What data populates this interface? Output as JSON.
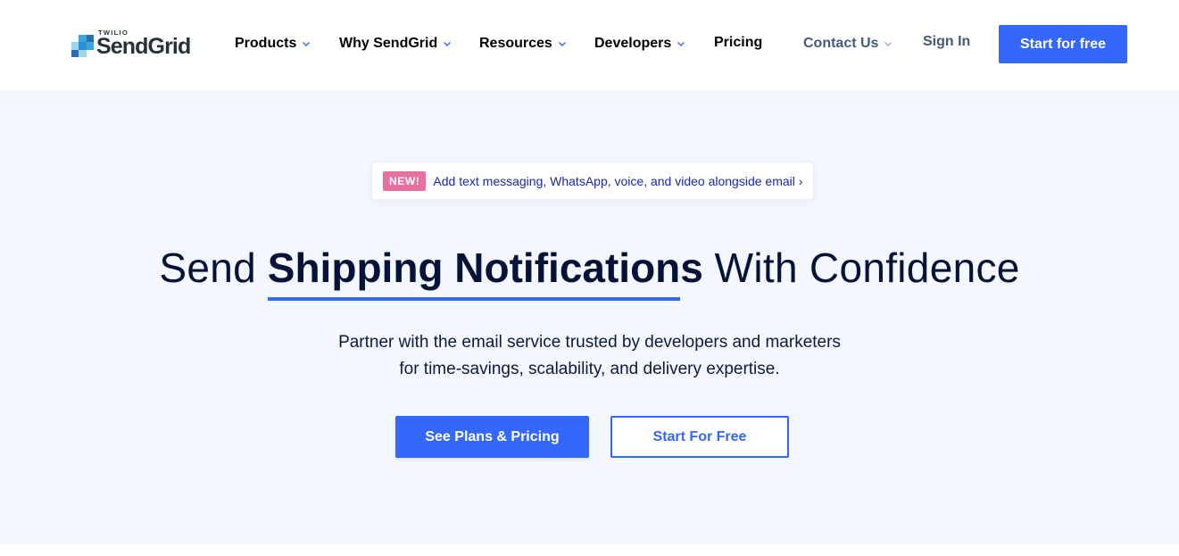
{
  "header": {
    "logo": {
      "small_text": "TWILIO",
      "brand": "SendGrid"
    },
    "nav": [
      {
        "label": "Products",
        "has_dropdown": true
      },
      {
        "label": "Why SendGrid",
        "has_dropdown": true
      },
      {
        "label": "Resources",
        "has_dropdown": true
      },
      {
        "label": "Developers",
        "has_dropdown": true
      },
      {
        "label": "Pricing",
        "has_dropdown": false
      }
    ],
    "contact_label": "Contact Us",
    "signin_label": "Sign In",
    "cta_label": "Start for free"
  },
  "hero": {
    "announcement": {
      "badge": "NEW!",
      "text": "Add text messaging, WhatsApp, voice, and video alongside email ›"
    },
    "headline": {
      "prefix": "Send",
      "highlight": "Shipping Notifications",
      "suffix": "With Confidence"
    },
    "subtitle_line1": "Partner with the email service trusted by developers and marketers",
    "subtitle_line2": "for time-savings, scalability, and delivery expertise.",
    "primary_button": "See Plans & Pricing",
    "secondary_button": "Start For Free"
  },
  "colors": {
    "brand_blue": "#3368fa",
    "badge_pink": "#e8709f",
    "hero_bg": "#f4f7ff",
    "text_dark": "#051336",
    "nav_secondary": "#435a7c"
  }
}
